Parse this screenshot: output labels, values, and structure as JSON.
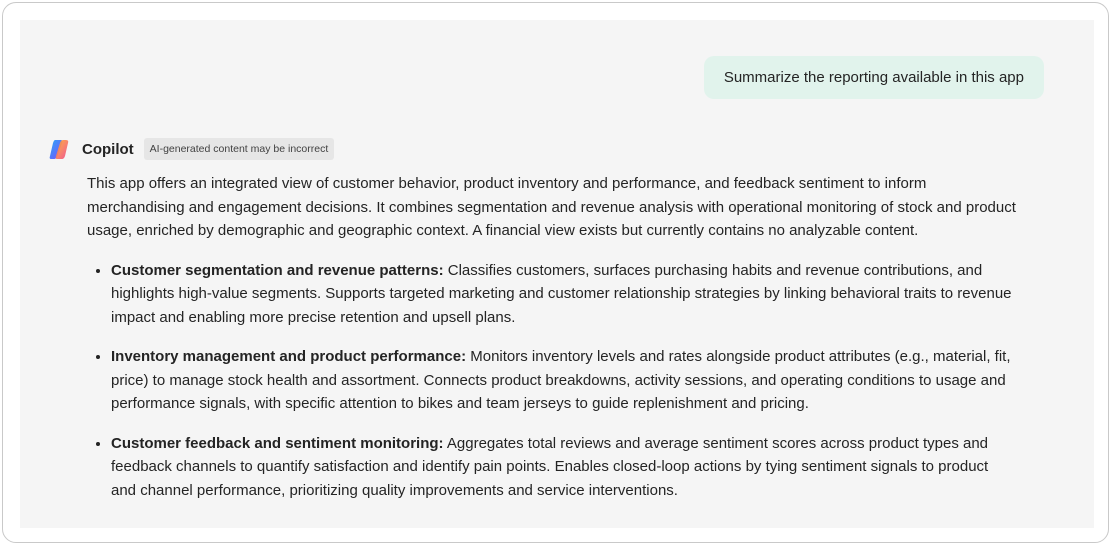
{
  "user_message": "Summarize the reporting available in this app",
  "assistant": {
    "name": "Copilot",
    "badge": "AI-generated content may be incorrect",
    "intro": "This app offers an integrated view of customer behavior, product inventory and performance, and feedback sentiment to inform merchandising and engagement decisions. It combines segmentation and revenue analysis with operational monitoring of stock and product usage, enriched by demographic and geographic context. A financial view exists but currently contains no analyzable content.",
    "bullets": [
      {
        "title": "Customer segmentation and revenue patterns:",
        "text": " Classifies customers, surfaces purchasing habits and revenue contributions, and highlights high-value segments. Supports targeted marketing and customer relationship strategies by linking behavioral traits to revenue impact and enabling more precise retention and upsell plans."
      },
      {
        "title": "Inventory management and product performance:",
        "text": " Monitors inventory levels and rates alongside product attributes (e.g., material, fit, price) to manage stock health and assortment. Connects product breakdowns, activity sessions, and operating conditions to usage and performance signals, with specific attention to bikes and team jerseys to guide replenishment and pricing."
      },
      {
        "title": "Customer feedback and sentiment monitoring:",
        "text": " Aggregates total reviews and average sentiment scores across product types and feedback channels to quantify satisfaction and identify pain points. Enables closed-loop actions by tying sentiment signals to product and channel performance, prioritizing quality improvements and service interventions."
      }
    ]
  },
  "colors": {
    "chat_bg": "#f5f5f5",
    "user_bubble_bg": "#e1f3ec",
    "badge_bg": "#e6e6e6"
  },
  "icons": {
    "logo": "copilot-logo-icon"
  }
}
